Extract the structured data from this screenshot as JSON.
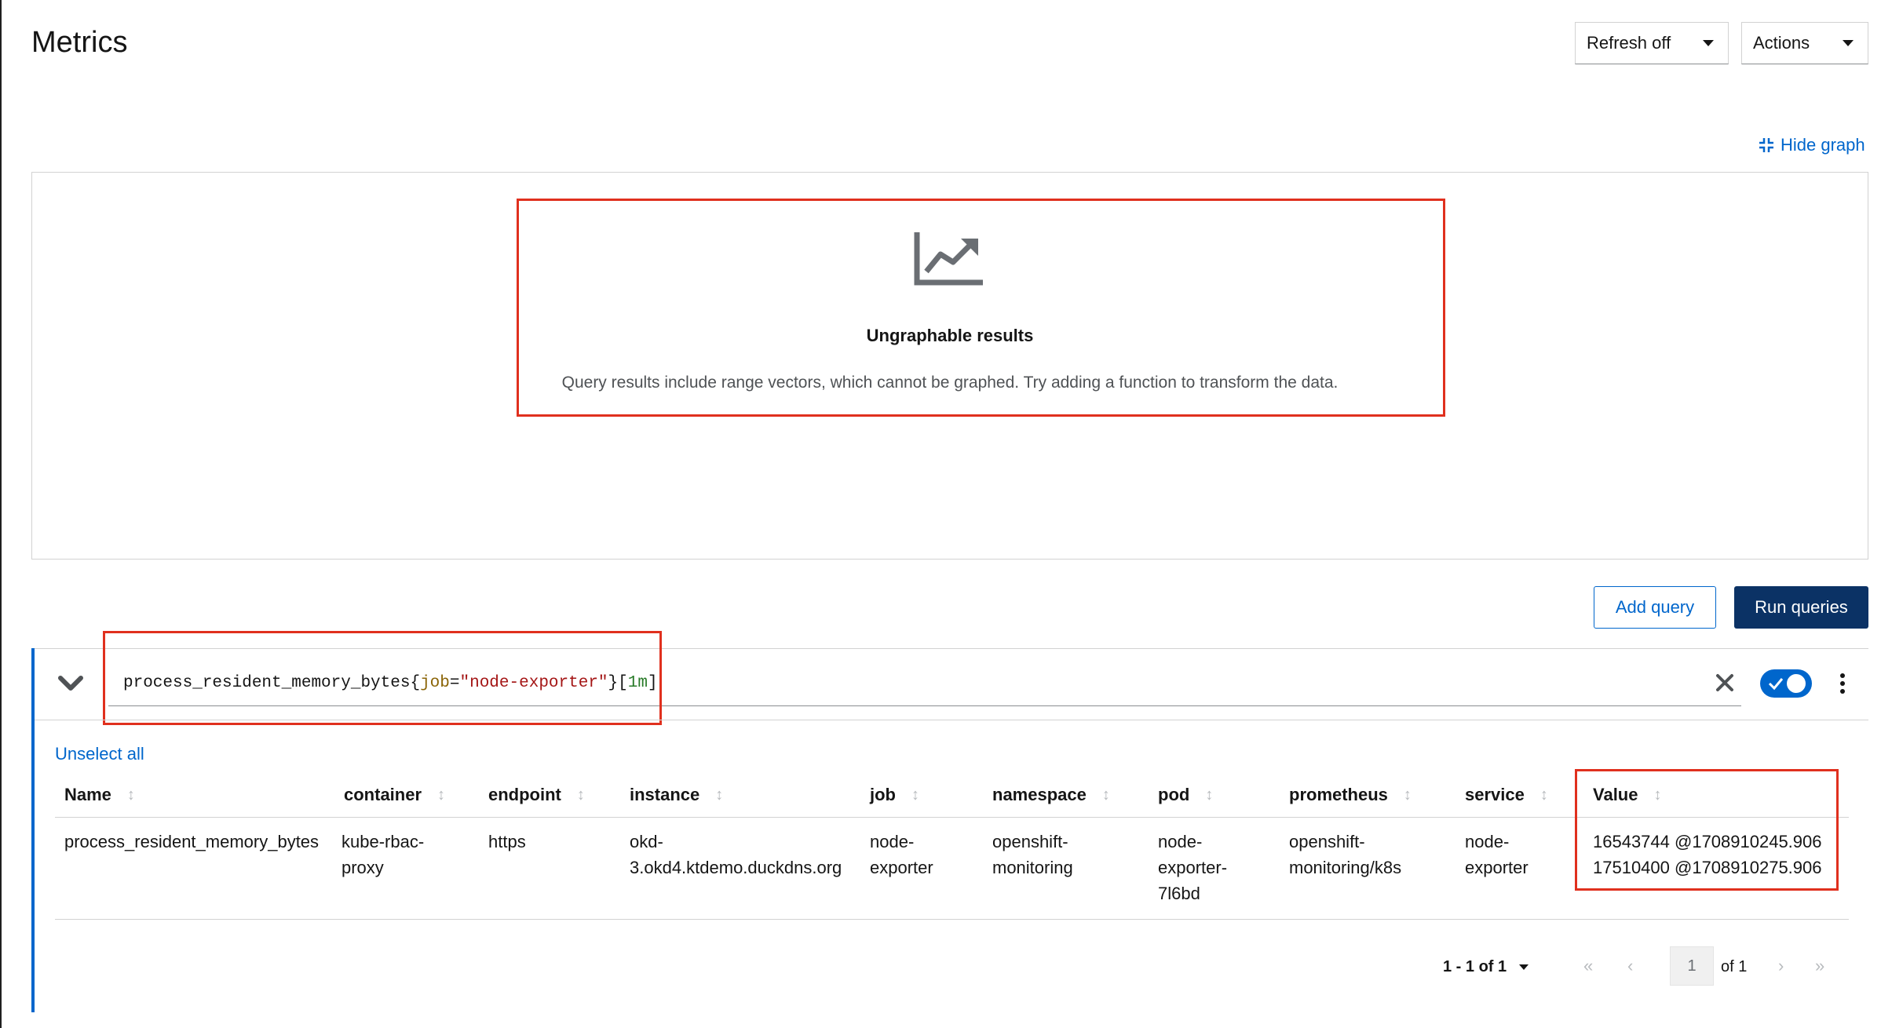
{
  "header": {
    "title": "Metrics",
    "refresh_label": "Refresh off",
    "actions_label": "Actions"
  },
  "graph": {
    "hide_graph_label": "Hide graph",
    "empty_title": "Ungraphable results",
    "empty_body": "Query results include range vectors, which cannot be graphed. Try adding a function to transform the data."
  },
  "buttons": {
    "add_query": "Add query",
    "run_queries": "Run queries"
  },
  "query": {
    "metric": "process_resident_memory_bytes",
    "brace_open": "{",
    "label_key": "job",
    "equals": "=",
    "label_value": "\"node-exporter\"",
    "brace_close": "}",
    "bracket_open": "[",
    "range": "1m",
    "bracket_close": "]",
    "enabled": true
  },
  "results": {
    "unselect_all": "Unselect all",
    "columns": [
      "Name",
      "container",
      "endpoint",
      "instance",
      "job",
      "namespace",
      "pod",
      "prometheus",
      "service",
      "Value"
    ],
    "row": {
      "name": "process_resident_memory_bytes",
      "container_1": "kube-rbac-",
      "container_2": "proxy",
      "endpoint": "https",
      "instance_1": "okd-",
      "instance_2": "3.okd4.ktdemo.duckdns.org",
      "job_1": "node-",
      "job_2": "exporter",
      "namespace_1": "openshift-",
      "namespace_2": "monitoring",
      "pod_1": "node-",
      "pod_2": "exporter-",
      "pod_3": "7l6bd",
      "prometheus_1": "openshift-",
      "prometheus_2": "monitoring/k8s",
      "service_1": "node-",
      "service_2": "exporter",
      "value_1": "16543744 @1708910245.906",
      "value_2": "17510400 @1708910275.906"
    }
  },
  "pagination": {
    "range_label": "1 - 1 of 1",
    "page": "1",
    "of_label": "of 1",
    "first": "«",
    "prev": "‹",
    "next": "›",
    "last": "»"
  },
  "icons": {
    "chart": "chart-line-icon",
    "hide_graph": "compress-icon",
    "chevron": "chevron-down-icon",
    "clear": "close-icon",
    "kebab": "kebab-icon",
    "sort": "sort-icon"
  },
  "colors": {
    "link": "#0066cc",
    "primary_button": "#0b3265",
    "highlight": "#e0301e",
    "toggle": "#0066cc"
  }
}
